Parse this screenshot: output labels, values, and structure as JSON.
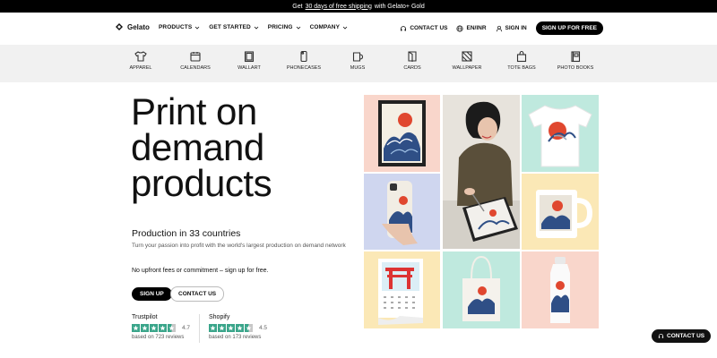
{
  "announcement": {
    "prefix": "Get",
    "link": "30 days of free shipping",
    "suffix": "with Gelato+ Gold"
  },
  "nav": {
    "logo": "Gelato",
    "links": [
      "PRODUCTS",
      "GET STARTED",
      "PRICING",
      "COMPANY"
    ],
    "contact": "CONTACT US",
    "locale": "EN/INR",
    "signin": "SIGN IN",
    "signup": "SIGN UP FOR FREE"
  },
  "categories": [
    "APPAREL",
    "CALENDARS",
    "WALLART",
    "PHONECASES",
    "MUGS",
    "CARDS",
    "WALLPAPER",
    "TOTE BAGS",
    "PHOTO BOOKS"
  ],
  "hero": {
    "title": [
      "Print on",
      "demand",
      "products"
    ],
    "subhead": "Production in 33 countries",
    "description": "Turn your passion into profit with the world's largest production on demand network",
    "nofee": "No upfront fees or commitment – sign up for free.",
    "cta_primary": "SIGN UP",
    "cta_secondary": "CONTACT US"
  },
  "ratings": [
    {
      "source": "Trustpilot",
      "score": "4.7",
      "reviews": "based on 723 reviews",
      "stars": 4.5
    },
    {
      "source": "Shopify",
      "score": "4.5",
      "reviews": "based on 173 reviews",
      "stars": 4.5
    }
  ],
  "floating_contact": "CONTACT US",
  "colors": {
    "accent": "#000000",
    "star": "#3aa58a",
    "pink": "#f9d6cb",
    "mint": "#bfe9de",
    "lavender": "#cfd6ef",
    "yellow": "#fbe8b6"
  }
}
